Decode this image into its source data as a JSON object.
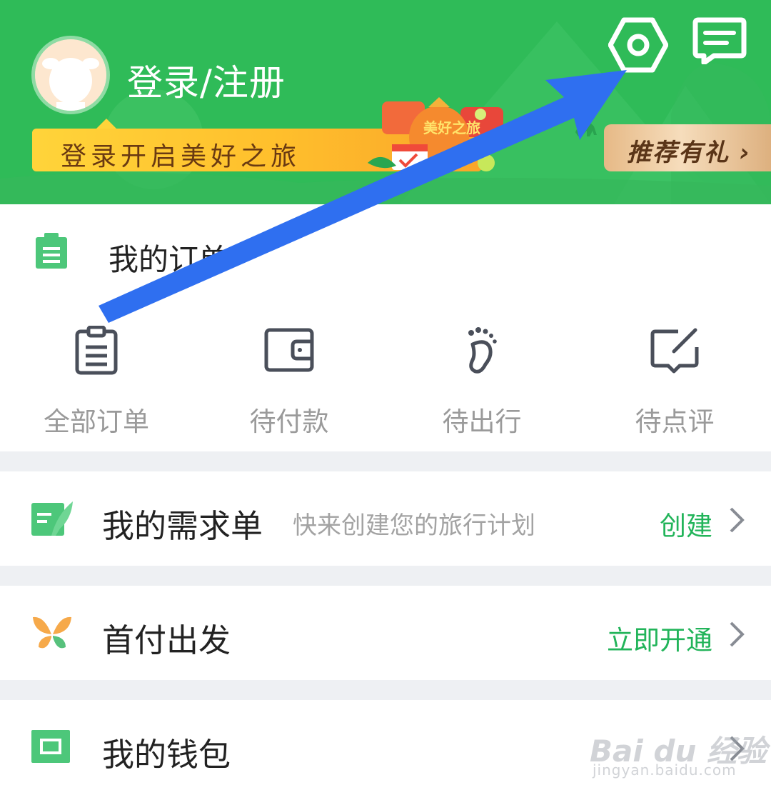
{
  "header": {
    "login_label": "登录/注册",
    "banner_text": "登录开启美好之旅",
    "banner_badge": "美好之旅",
    "recommend_label": "推荐有礼 ›",
    "settings_icon": "settings-hexagon-icon",
    "message_icon": "message-icon"
  },
  "orders": {
    "title": "我的订单",
    "items": [
      {
        "label": "全部订单",
        "icon": "clipboard-icon"
      },
      {
        "label": "待付款",
        "icon": "wallet-icon"
      },
      {
        "label": "待出行",
        "icon": "footprint-icon"
      },
      {
        "label": "待点评",
        "icon": "comment-edit-icon"
      }
    ]
  },
  "rows": {
    "demand": {
      "title": "我的需求单",
      "subtitle": "快来创建您的旅行计划",
      "action": "创建"
    },
    "first_pay": {
      "title": "首付出发",
      "action": "立即开通"
    },
    "wallet": {
      "title": "我的钱包"
    }
  },
  "watermark": {
    "brand": "Bai du 经验",
    "url": "jingyan.baidu.com"
  },
  "colors": {
    "header_green": "#2fbb58",
    "accent_green": "#22b45a",
    "arrow_blue": "#2f6ff0",
    "banner_yellow": "#ffd43a"
  }
}
